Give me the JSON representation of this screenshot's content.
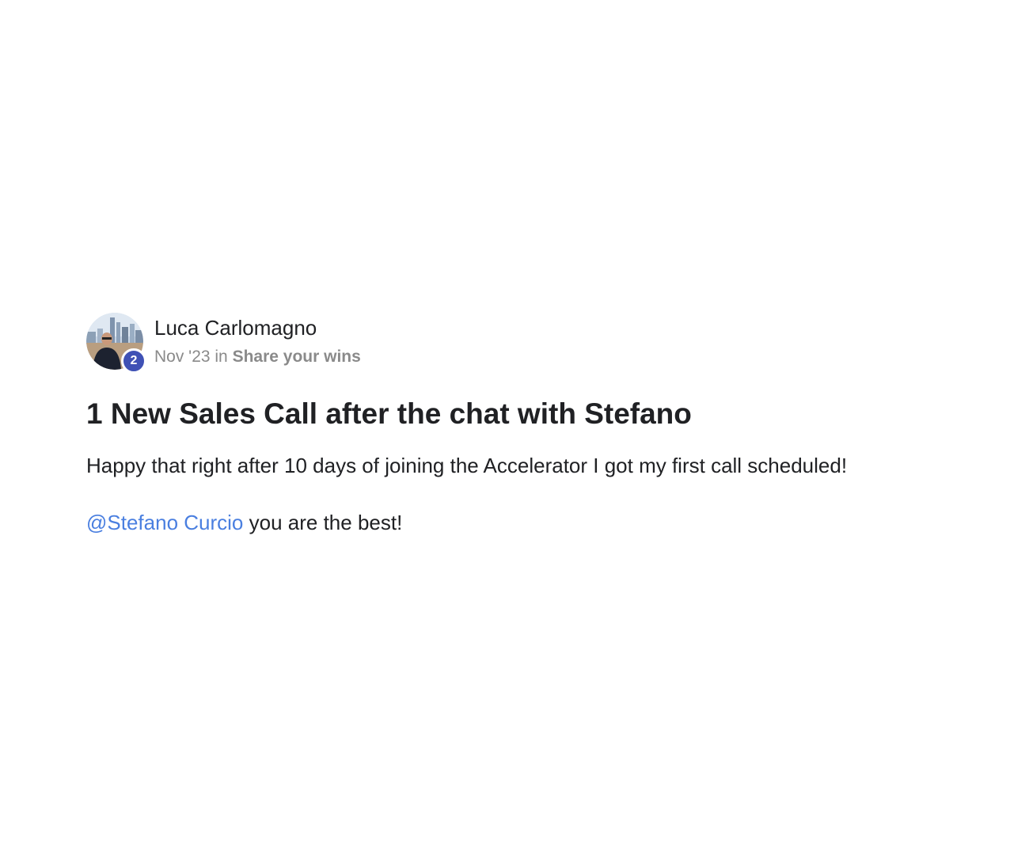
{
  "post": {
    "author": {
      "name": "Luca Carlomagno",
      "level": "2"
    },
    "date": "Nov '23",
    "in_label": "in",
    "category": "Share your wins",
    "title": "1 New Sales Call after the chat with Stefano",
    "body": {
      "paragraph1": "Happy that right after 10 days of joining the Accelerator I got my first call scheduled!",
      "mention": "@Stefano Curcio",
      "paragraph2_rest": "you are the best!"
    }
  },
  "colors": {
    "badge": "#3f51b5",
    "mention_link": "#4a7fe0",
    "meta_text": "#8a8a8a",
    "primary_text": "#202124"
  }
}
